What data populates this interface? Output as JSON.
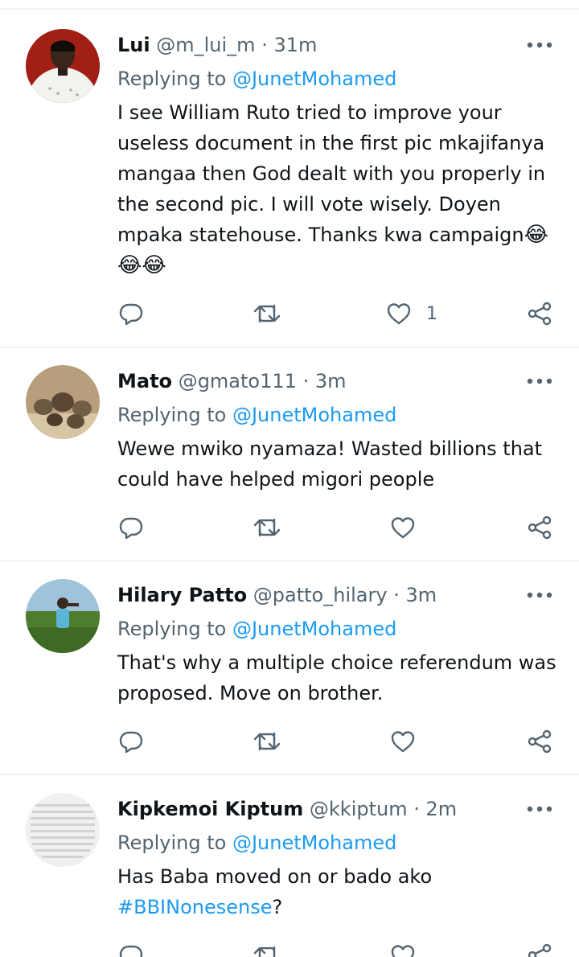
{
  "tweets": [
    {
      "name": "Lui",
      "handle": "@m_lui_m",
      "separator": "·",
      "time": "31m",
      "replying_label": "Replying to",
      "replying_to": "@JunetMohamed",
      "text": "I see William Ruto tried to improve your useless document in the first pic mkajifanya mangaa then God dealt with you properly in the second pic. I will vote wisely. Doyen mpaka statehouse. Thanks kwa campaign",
      "emojis": "😂😂😂",
      "like_count": "1"
    },
    {
      "name": "Mato",
      "handle": "@gmato111",
      "separator": "·",
      "time": "3m",
      "replying_label": "Replying to",
      "replying_to": "@JunetMohamed",
      "text": "Wewe mwiko nyamaza! Wasted billions that could have helped migori people"
    },
    {
      "name": "Hilary Patto",
      "handle": "@patto_hilary",
      "separator": "·",
      "time": "3m",
      "replying_label": "Replying to",
      "replying_to": "@JunetMohamed",
      "text": "That's why a multiple choice referendum was proposed. Move on brother."
    },
    {
      "name": "Kipkemoi Kiptum",
      "handle": "@kkiptum",
      "separator": "·",
      "time": "2m",
      "replying_label": "Replying to",
      "replying_to": "@JunetMohamed",
      "text": "Has Baba moved on or bado ako",
      "hashtag": "#BBINonesense",
      "trailing": "?"
    }
  ],
  "colors": {
    "link": "#1d9bf0",
    "secondary_text": "#536471",
    "divider": "#eff3f4"
  },
  "icons": {
    "reply": "speech-bubble-icon",
    "retweet": "retweet-arrows-icon",
    "like": "heart-icon",
    "share": "share-icon",
    "more": "three-dots-icon"
  }
}
